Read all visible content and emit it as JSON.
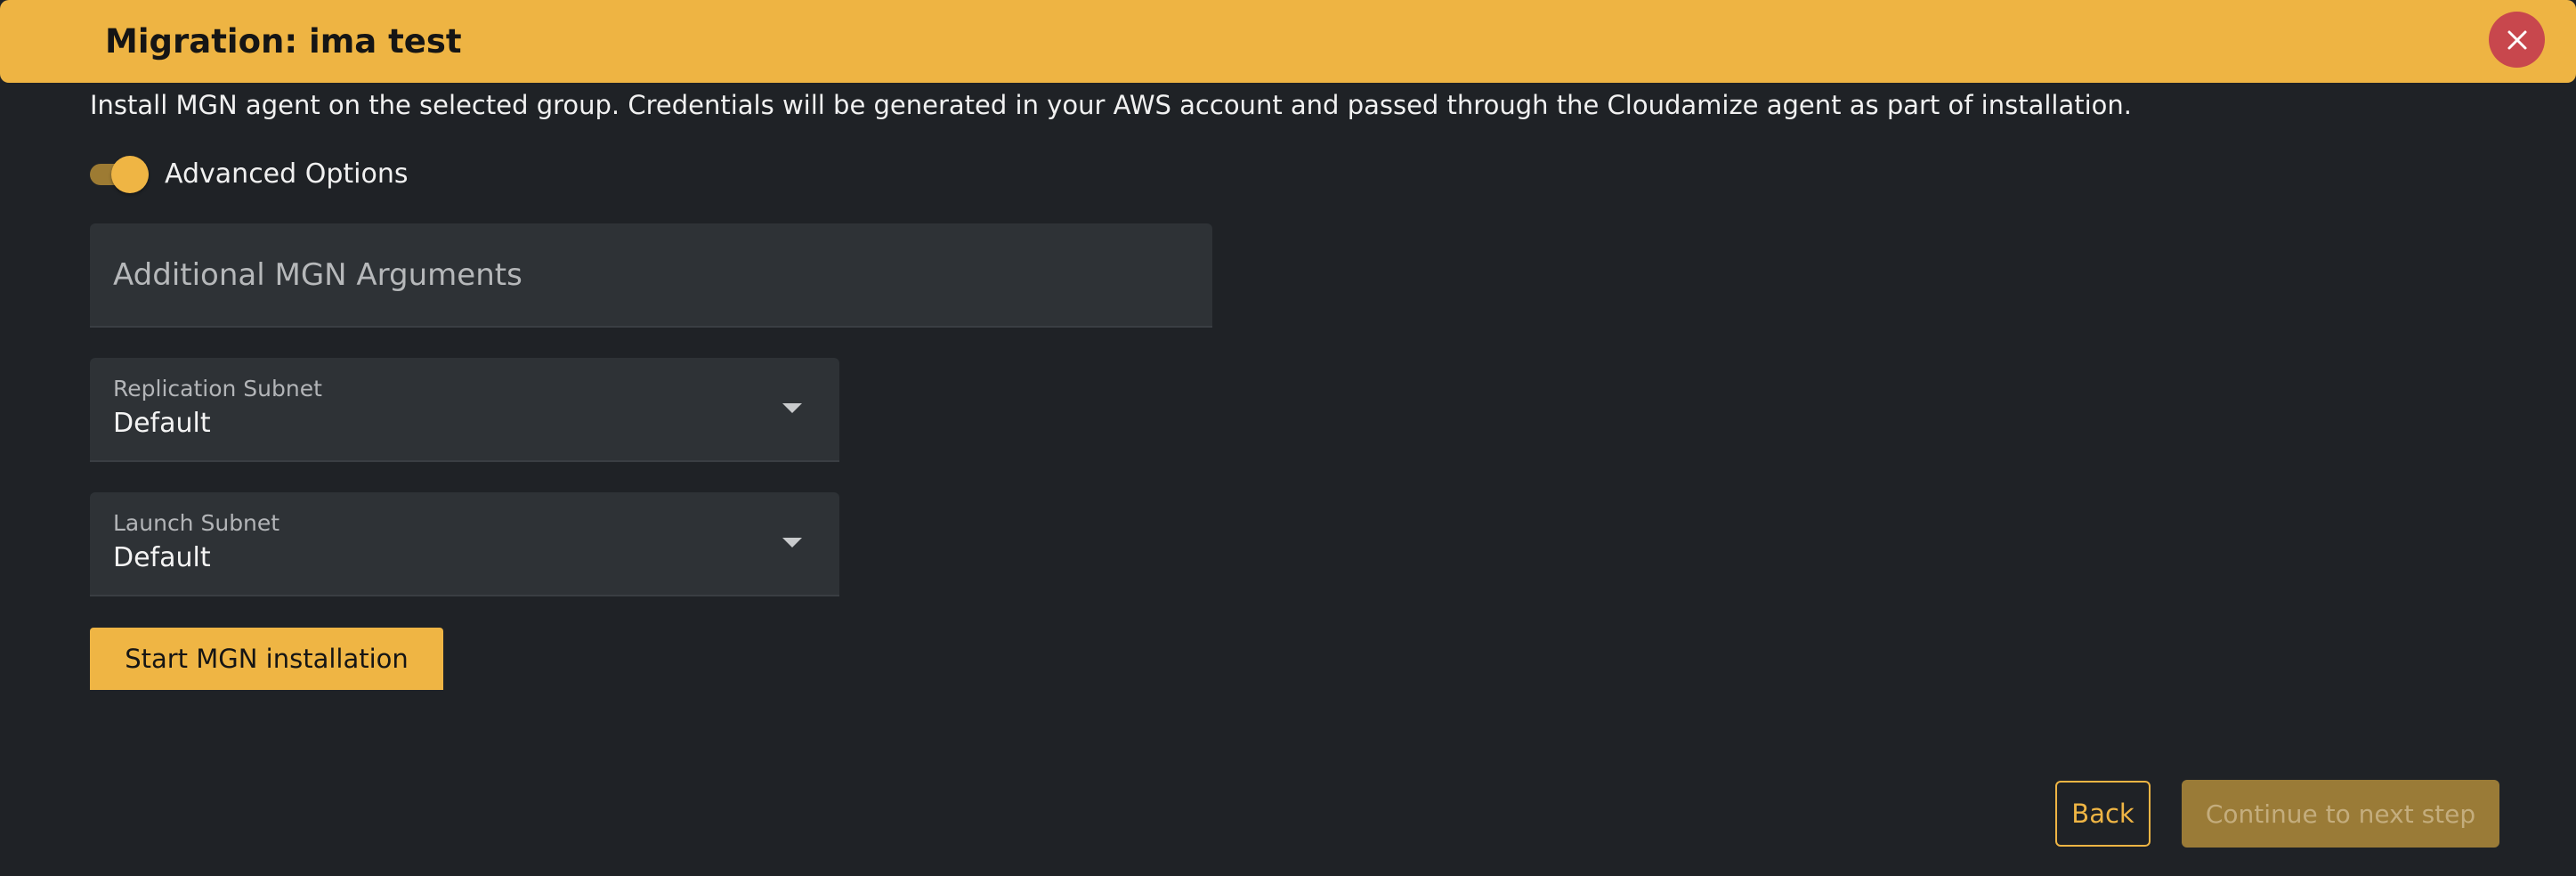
{
  "header": {
    "title": "Migration: ima test",
    "close_icon": "close-icon",
    "background_color": "#eeb443",
    "close_color": "#c8474d"
  },
  "description": "Install MGN agent on the selected group. Credentials will be generated in your AWS account and passed through the Cloudamize agent as part of installation.",
  "advanced_options": {
    "label": "Advanced Options",
    "enabled": true
  },
  "additional_arguments": {
    "placeholder": "Additional MGN Arguments",
    "value": ""
  },
  "replication_subnet": {
    "label": "Replication Subnet",
    "value": "Default"
  },
  "launch_subnet": {
    "label": "Launch Subnet",
    "value": "Default"
  },
  "actions": {
    "start_label": "Start MGN installation",
    "back_label": "Back",
    "next_label": "Continue to next step",
    "next_disabled": true
  },
  "colors": {
    "accent": "#efb544",
    "background": "#1f2226",
    "field": "#2e3236"
  }
}
